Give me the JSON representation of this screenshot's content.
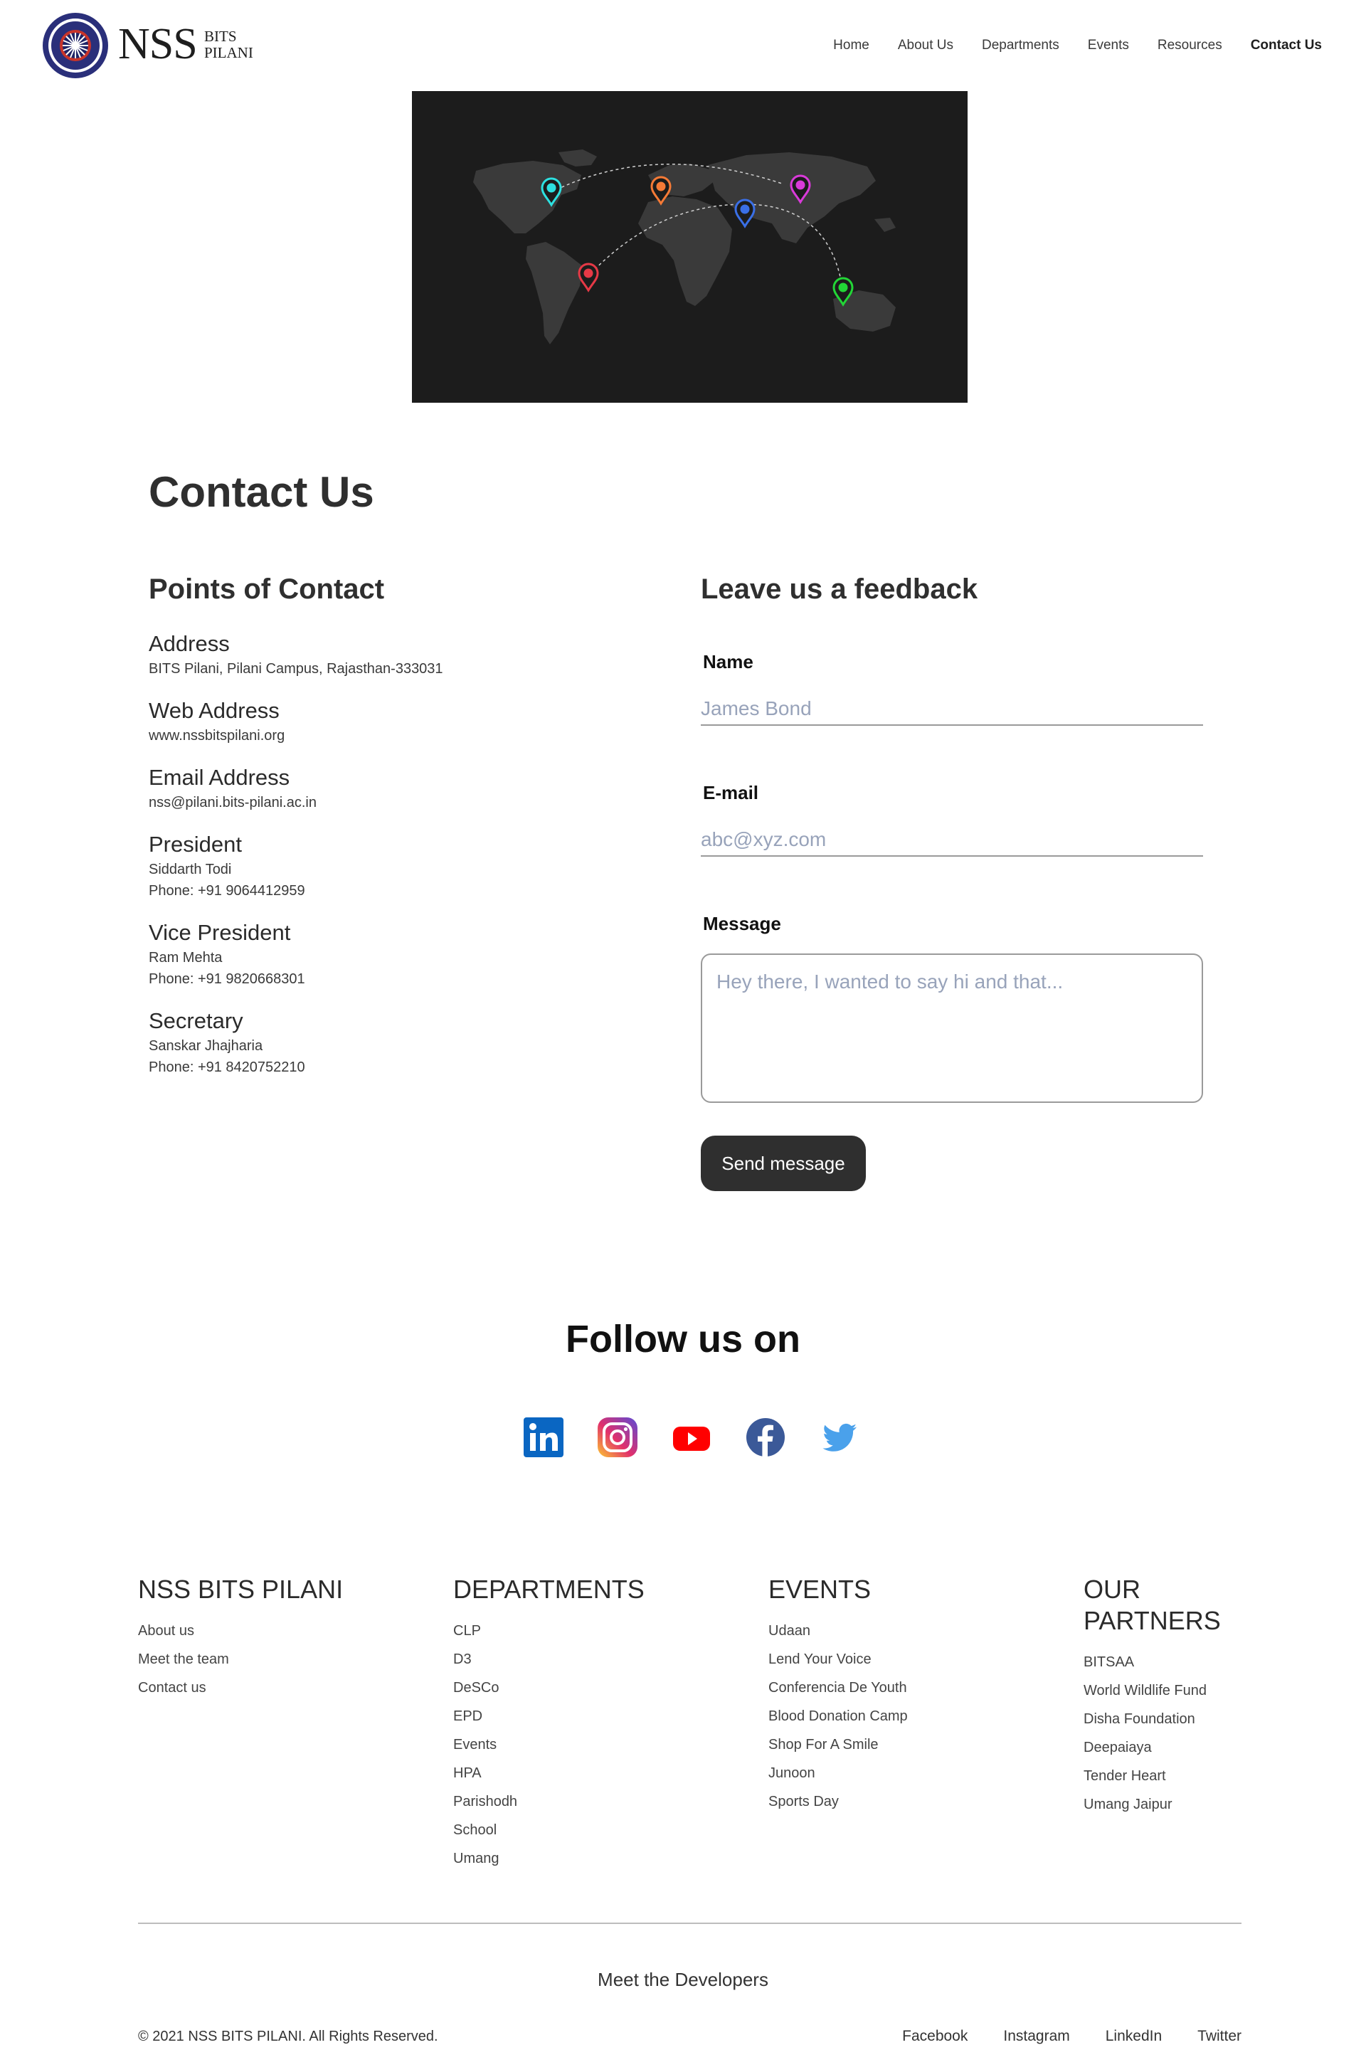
{
  "brand": {
    "name": "NSS",
    "sub_line1": "BITS",
    "sub_line2": "PILANI"
  },
  "nav": {
    "items": [
      "Home",
      "About Us",
      "Departments",
      "Events",
      "Resources",
      "Contact Us"
    ],
    "active": "Contact Us"
  },
  "map": {
    "pin_colors": [
      "#2de0e0",
      "#f57a36",
      "#d93ad9",
      "#3a6fe6",
      "#e63946",
      "#22d636"
    ],
    "background": "#1c1c1c"
  },
  "contact": {
    "title": "Contact Us",
    "points_title": "Points of Contact",
    "points": [
      {
        "label": "Address",
        "lines": [
          "BITS Pilani, Pilani Campus, Rajasthan-333031"
        ]
      },
      {
        "label": "Web Address",
        "lines": [
          "www.nssbitspilani.org"
        ]
      },
      {
        "label": "Email Address",
        "lines": [
          "nss@pilani.bits-pilani.ac.in"
        ]
      },
      {
        "label": "President",
        "lines": [
          "Siddarth Todi",
          "Phone: +91 9064412959"
        ]
      },
      {
        "label": "Vice President",
        "lines": [
          "Ram Mehta",
          "Phone: +91 9820668301"
        ]
      },
      {
        "label": "Secretary",
        "lines": [
          "Sanskar Jhajharia",
          "Phone: +91 8420752210"
        ]
      }
    ],
    "feedback_title": "Leave us a feedback",
    "form": {
      "name_label": "Name",
      "name_placeholder": "James Bond",
      "email_label": "E-mail",
      "email_placeholder": "abc@xyz.com",
      "message_label": "Message",
      "message_placeholder": "Hey there, I wanted to say hi and that...",
      "submit_label": "Send message"
    }
  },
  "follow": {
    "title": "Follow us on",
    "icons": [
      "linkedin-icon",
      "instagram-icon",
      "youtube-icon",
      "facebook-icon",
      "twitter-icon"
    ]
  },
  "footer": {
    "columns": [
      {
        "title": "NSS BITS PILANI",
        "links": [
          "About us",
          "Meet the team",
          "Contact us"
        ]
      },
      {
        "title": "DEPARTMENTS",
        "links": [
          "CLP",
          "D3",
          "DeSCo",
          "EPD",
          "Events",
          "HPA",
          "Parishodh",
          "School",
          "Umang"
        ]
      },
      {
        "title": "EVENTS",
        "links": [
          "Udaan",
          "Lend Your Voice",
          "Conferencia De Youth",
          "Blood Donation Camp",
          "Shop For A Smile",
          "Junoon",
          "Sports Day"
        ]
      },
      {
        "title": "OUR PARTNERS",
        "links": [
          "BITSAA",
          "World Wildlife Fund",
          "Disha Foundation",
          "Deepaiaya",
          "Tender Heart",
          "Umang Jaipur"
        ]
      }
    ],
    "developers_link": "Meet the Developers",
    "copyright": "© 2021 NSS BITS PILANI. All Rights Reserved.",
    "bottom_links": [
      "Facebook",
      "Instagram",
      "LinkedIn",
      "Twitter"
    ]
  }
}
